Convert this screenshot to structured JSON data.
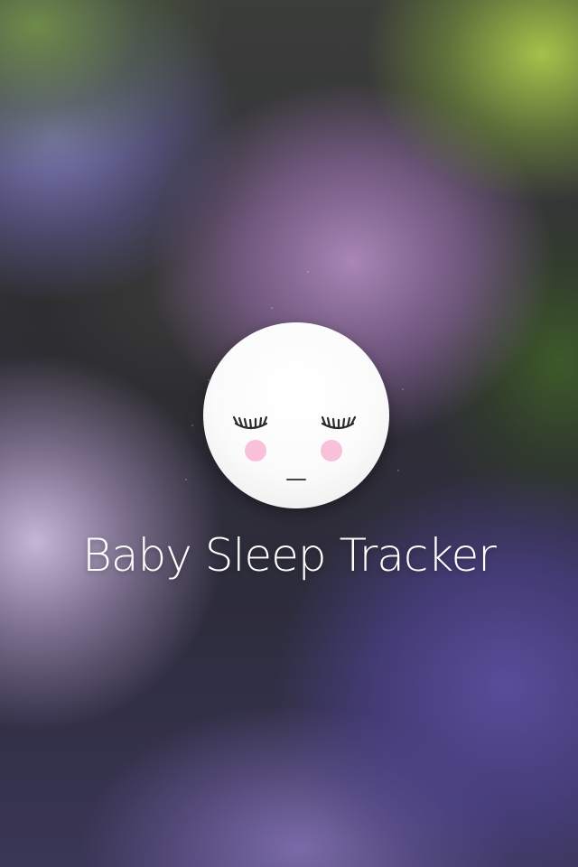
{
  "app": {
    "title": "Baby Sleep Tracker"
  },
  "logo": {
    "icon": "sleeping-baby-face-icon"
  },
  "colors": {
    "logo_face": "#ffffff",
    "cheeks": "#f7b6d2",
    "lashes": "#2b2b2b",
    "title_text": "#ffffff"
  }
}
